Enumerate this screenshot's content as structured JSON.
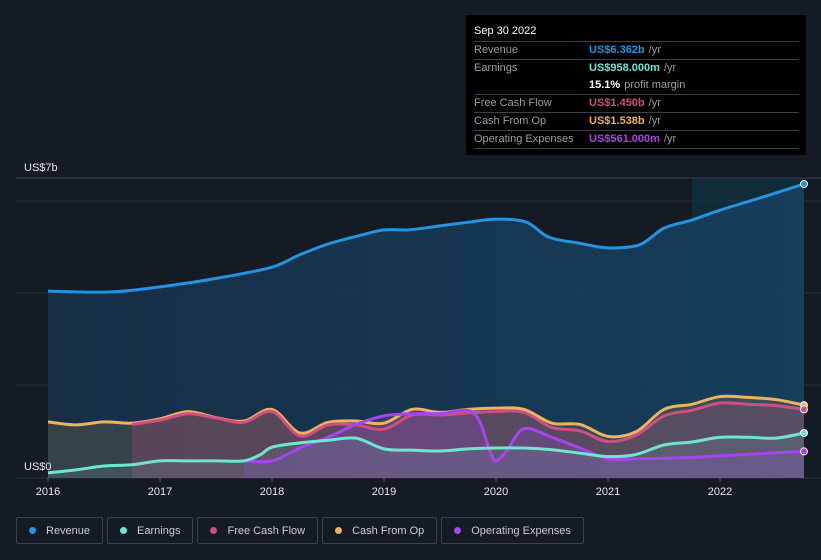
{
  "tooltip": {
    "date": "Sep 30 2022",
    "rows": [
      {
        "label": "Revenue",
        "value": "US$6.362b",
        "unit": "/yr",
        "color": "#2394df"
      },
      {
        "label": "Earnings",
        "value": "US$958.000m",
        "unit": "/yr",
        "color": "#6ee5d1"
      },
      {
        "label": "",
        "value": "15.1%",
        "unit": "profit margin",
        "color": "#ffffff"
      },
      {
        "label": "Free Cash Flow",
        "value": "US$1.450b",
        "unit": "/yr",
        "color": "#d24d84"
      },
      {
        "label": "Cash From Op",
        "value": "US$1.538b",
        "unit": "/yr",
        "color": "#eeb35c"
      },
      {
        "label": "Operating Expenses",
        "value": "US$561.000m",
        "unit": "/yr",
        "color": "#a645ee"
      }
    ]
  },
  "legend": [
    {
      "label": "Revenue",
      "color": "#2394df"
    },
    {
      "label": "Earnings",
      "color": "#6ee5d1"
    },
    {
      "label": "Free Cash Flow",
      "color": "#d24d84"
    },
    {
      "label": "Cash From Op",
      "color": "#eeb35c"
    },
    {
      "label": "Operating Expenses",
      "color": "#a645ee"
    }
  ],
  "chart_data": {
    "type": "area",
    "title": "",
    "xlabel": "",
    "ylabel": "",
    "y_top_label": "US$7b",
    "y_bottom_label": "US$0",
    "ylim": [
      0,
      7
    ],
    "xlim": [
      2016.0,
      2022.75
    ],
    "x_ticks": [
      "2016",
      "2017",
      "2018",
      "2019",
      "2020",
      "2021",
      "2022"
    ],
    "forecast_shade_from": 2021.75,
    "series": [
      {
        "name": "Revenue",
        "color": "#2394df",
        "x": [
          2016.0,
          2016.55,
          2017.0,
          2017.53,
          2018.0,
          2018.24,
          2018.5,
          2018.77,
          2019.0,
          2019.22,
          2019.49,
          2019.76,
          2020.0,
          2020.27,
          2020.47,
          2020.74,
          2021.0,
          2021.28,
          2021.5,
          2021.75,
          2022.0,
          2022.35,
          2022.75
        ],
        "values": [
          4.36,
          4.34,
          4.46,
          4.67,
          4.92,
          5.2,
          5.46,
          5.65,
          5.79,
          5.79,
          5.88,
          5.97,
          6.04,
          5.97,
          5.62,
          5.48,
          5.37,
          5.44,
          5.83,
          6.02,
          6.25,
          6.53,
          6.86
        ]
      },
      {
        "name": "Earnings",
        "color": "#6ee5d1",
        "x": [
          2016.0,
          2016.25,
          2016.5,
          2016.75,
          2017.0,
          2017.25,
          2017.5,
          2017.75,
          2017.9,
          2018.0,
          2018.25,
          2018.5,
          2018.75,
          2019.0,
          2019.25,
          2019.5,
          2019.75,
          2020.0,
          2020.25,
          2020.5,
          2020.75,
          2021.0,
          2021.25,
          2021.5,
          2021.75,
          2022.0,
          2022.25,
          2022.5,
          2022.75
        ],
        "values": [
          0.12,
          0.19,
          0.28,
          0.31,
          0.4,
          0.4,
          0.4,
          0.4,
          0.55,
          0.72,
          0.82,
          0.88,
          0.93,
          0.68,
          0.65,
          0.63,
          0.68,
          0.7,
          0.7,
          0.66,
          0.58,
          0.5,
          0.55,
          0.77,
          0.84,
          0.95,
          0.95,
          0.93,
          1.05
        ]
      },
      {
        "name": "Free Cash Flow",
        "color": "#d24d84",
        "x": [
          2016.75,
          2017.0,
          2017.25,
          2017.5,
          2017.75,
          2018.0,
          2018.25,
          2018.5,
          2018.75,
          2019.0,
          2019.25,
          2019.5,
          2019.75,
          2020.0,
          2020.25,
          2020.5,
          2020.75,
          2021.0,
          2021.25,
          2021.5,
          2021.75,
          2022.0,
          2022.25,
          2022.5,
          2022.75
        ],
        "values": [
          1.25,
          1.35,
          1.5,
          1.4,
          1.3,
          1.55,
          0.98,
          1.24,
          1.24,
          1.14,
          1.47,
          1.47,
          1.52,
          1.55,
          1.53,
          1.18,
          1.1,
          0.85,
          1.0,
          1.45,
          1.58,
          1.75,
          1.72,
          1.69,
          1.6
        ]
      },
      {
        "name": "Cash From Op",
        "color": "#eeb35c",
        "x": [
          2016.0,
          2016.25,
          2016.5,
          2016.75,
          2017.0,
          2017.25,
          2017.5,
          2017.75,
          2018.0,
          2018.25,
          2018.5,
          2018.75,
          2019.0,
          2019.25,
          2019.5,
          2019.75,
          2020.0,
          2020.25,
          2020.5,
          2020.75,
          2021.0,
          2021.25,
          2021.5,
          2021.75,
          2022.0,
          2022.25,
          2022.5,
          2022.75
        ],
        "values": [
          1.31,
          1.24,
          1.31,
          1.28,
          1.38,
          1.55,
          1.41,
          1.33,
          1.6,
          1.05,
          1.3,
          1.33,
          1.28,
          1.6,
          1.53,
          1.6,
          1.63,
          1.6,
          1.28,
          1.25,
          0.97,
          1.08,
          1.6,
          1.72,
          1.9,
          1.88,
          1.83,
          1.7
        ]
      },
      {
        "name": "Operating Expenses",
        "color": "#a645ee",
        "x": [
          2017.75,
          2018.0,
          2018.25,
          2018.5,
          2018.75,
          2019.0,
          2019.25,
          2019.5,
          2019.8,
          2019.95,
          2020.0,
          2020.1,
          2020.25,
          2020.5,
          2020.75,
          2021.0,
          2021.25,
          2021.5,
          2021.75,
          2022.0,
          2022.25,
          2022.5,
          2022.75
        ],
        "values": [
          0.4,
          0.4,
          0.7,
          0.95,
          1.25,
          1.45,
          1.5,
          1.5,
          1.52,
          0.6,
          0.4,
          0.65,
          1.15,
          0.95,
          0.7,
          0.45,
          0.45,
          0.46,
          0.48,
          0.52,
          0.55,
          0.59,
          0.62
        ]
      }
    ]
  }
}
